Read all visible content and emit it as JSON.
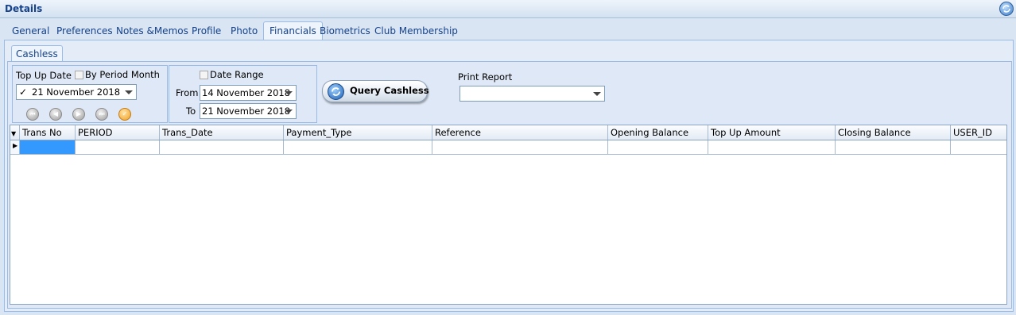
{
  "window": {
    "title": "Details"
  },
  "tabs": [
    {
      "label": "General"
    },
    {
      "label": "Preferences"
    },
    {
      "label": "Notes &Memos"
    },
    {
      "label": "Profile"
    },
    {
      "label": "Photo"
    },
    {
      "label": "Financials",
      "active": true
    },
    {
      "label": "Biometrics"
    },
    {
      "label": "Club Membership"
    }
  ],
  "subtab": {
    "label": "Cashless"
  },
  "topup": {
    "label": "Top Up Date",
    "by_period_label": "By Period Month",
    "date_value": "21 November 2018",
    "date_checked": true
  },
  "range": {
    "label": "Date Range",
    "from_label": "From",
    "from_value": "14 November 2018",
    "to_label": "To",
    "to_value": "21 November 2018"
  },
  "query_button": {
    "label": "Query Cashless"
  },
  "print_report": {
    "label": "Print Report",
    "value": ""
  },
  "grid": {
    "columns": [
      "Trans No",
      "PERIOD",
      "Trans_Date",
      "Payment_Type",
      "Reference",
      "Opening Balance",
      "Top Up Amount",
      "Closing Balance",
      "USER_ID"
    ],
    "rows": [
      [
        "",
        "",
        "",
        "",
        "",
        "",
        "",
        "",
        ""
      ]
    ]
  },
  "icons": {
    "refresh": "refresh-icon",
    "query": "query-refresh-icon",
    "nav": [
      "first-icon",
      "prev-icon",
      "next-icon",
      "last-icon",
      "confirm-icon"
    ]
  }
}
